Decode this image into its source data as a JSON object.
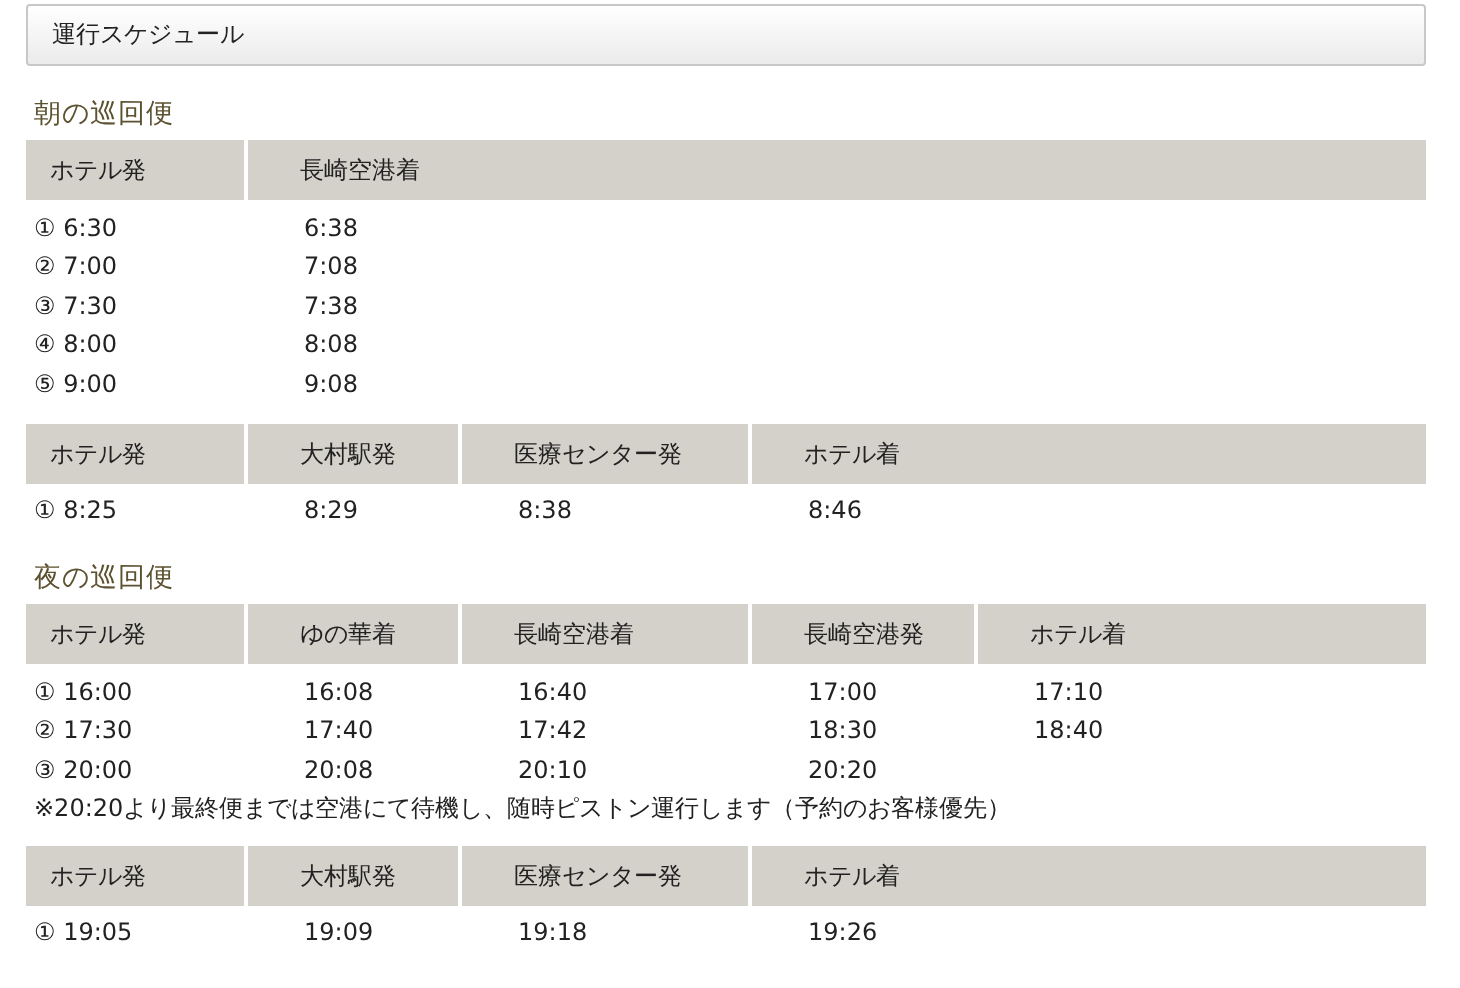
{
  "title": "運行スケジュール",
  "sections": [
    {
      "heading": "朝の巡回便",
      "tables": [
        {
          "columns": [
            "ホテル発",
            "長崎空港着"
          ],
          "rows": [
            [
              "① 6:30",
              "6:38"
            ],
            [
              "② 7:00",
              "7:08"
            ],
            [
              "③ 7:30",
              "7:38"
            ],
            [
              "④ 8:00",
              "8:08"
            ],
            [
              "⑤ 9:00",
              "9:08"
            ]
          ]
        },
        {
          "columns": [
            "ホテル発",
            "大村駅発",
            "医療センター発",
            "ホテル着"
          ],
          "rows": [
            [
              "① 8:25",
              "8:29",
              "8:38",
              "8:46"
            ]
          ]
        }
      ]
    },
    {
      "heading": "夜の巡回便",
      "tables": [
        {
          "columns": [
            "ホテル発",
            "ゆの華着",
            "長崎空港着",
            "長崎空港発",
            "ホテル着"
          ],
          "rows": [
            [
              "① 16:00",
              "16:08",
              "16:40",
              "17:00",
              "17:10"
            ],
            [
              "② 17:30",
              "17:40",
              "17:42",
              "18:30",
              "18:40"
            ],
            [
              "③ 20:00",
              "20:08",
              "20:10",
              "20:20"
            ]
          ],
          "note": "※20:20より最終便までは空港にて待機し、随時ピストン運行します（予約のお客様優先）"
        },
        {
          "columns": [
            "ホテル発",
            "大村駅発",
            "医療センター発",
            "ホテル着"
          ],
          "rows": [
            [
              "① 19:05",
              "19:09",
              "19:18",
              "19:26"
            ]
          ]
        }
      ]
    }
  ]
}
